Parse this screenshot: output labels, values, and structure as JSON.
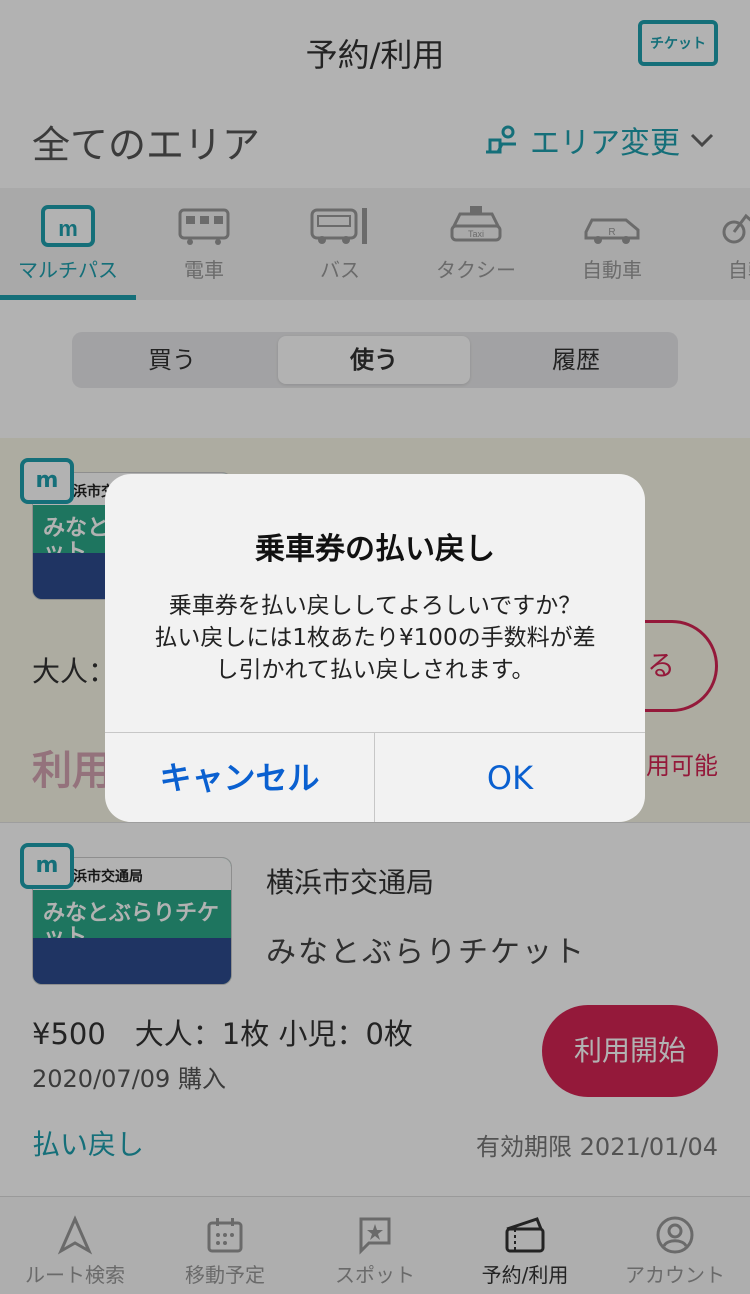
{
  "header": {
    "title": "予約/利用",
    "ticket_label": "チケット"
  },
  "area": {
    "name": "全てのエリア",
    "change_label": "エリア変更"
  },
  "categories": [
    {
      "label": "マルチパス",
      "icon": "multipass-icon",
      "active": true
    },
    {
      "label": "電車",
      "icon": "train-icon"
    },
    {
      "label": "バス",
      "icon": "bus-icon"
    },
    {
      "label": "タクシー",
      "icon": "taxi-icon"
    },
    {
      "label": "自動車",
      "icon": "car-icon"
    },
    {
      "label": "自転",
      "icon": "bicycle-icon"
    }
  ],
  "segments": [
    {
      "label": "買う"
    },
    {
      "label": "使う",
      "active": true
    },
    {
      "label": "履歴"
    }
  ],
  "card1": {
    "thumb_operator": "浜市交",
    "thumb_title": "みなとぶらりチケット",
    "adult": "大人：",
    "action_partial": "る",
    "use_partial": "利用",
    "avail_partial": "用可能"
  },
  "card2": {
    "thumb_operator": "浜市交通局",
    "thumb_title": "みなとぶらりチケット",
    "operator": "横浜市交通局",
    "ticket_name": "みなとぶらりチケット",
    "price_line": "¥500　大人：1枚 小児：0枚",
    "purchase_date": "2020/07/09 購入",
    "start_button": "利用開始",
    "refund_link": "払い戻し",
    "expiry": "有効期限 2021/01/04"
  },
  "tabbar": [
    {
      "label": "ルート検索",
      "icon": "navigation-arrow-icon"
    },
    {
      "label": "移動予定",
      "icon": "calendar-icon"
    },
    {
      "label": "スポット",
      "icon": "spot-flag-icon"
    },
    {
      "label": "予約/利用",
      "icon": "ticket-icon",
      "active": true
    },
    {
      "label": "アカウント",
      "icon": "account-icon"
    }
  ],
  "dialog": {
    "title": "乗車券の払い戻し",
    "message_line1": "乗車券を払い戻ししてよろしいですか？",
    "message_line2": "払い戻しには1枚あたり¥100の手数料が差",
    "message_line3": "し引かれて払い戻しされます。",
    "cancel_label": "キャンセル",
    "ok_label": "OK"
  },
  "colors": {
    "accent": "#1fa0ae",
    "primary_button": "#d42453",
    "dialog_link": "#0a60d0"
  }
}
